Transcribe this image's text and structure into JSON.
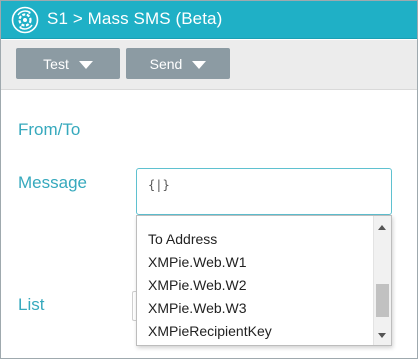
{
  "header": {
    "title": "S1 > Mass SMS (Beta)",
    "icon": "gear-cycle-icon"
  },
  "toolbar": {
    "test_label": "Test",
    "send_label": "Send"
  },
  "form": {
    "from_to_label": "From/To",
    "message_label": "Message",
    "list_label": "List",
    "insert_button_glyph": "{|}"
  },
  "dropdown": {
    "items": [
      "To Address",
      "XMPie.Web.W1",
      "XMPie.Web.W2",
      "XMPie.Web.W3",
      "XMPieRecipientKey"
    ]
  },
  "colors": {
    "header_bg": "#1fb0c6",
    "toolbar_button": "#8c9ba3",
    "label_text": "#36a9bd",
    "focus_border": "#5fc1d0"
  }
}
